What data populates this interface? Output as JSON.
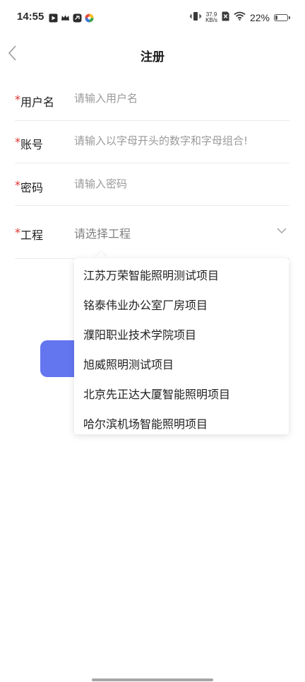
{
  "status_bar": {
    "time": "14:55",
    "net_speed_value": "37.9",
    "net_speed_unit": "KB/s",
    "battery_percent": "22%",
    "battery_level": 0.22
  },
  "nav": {
    "title": "注册"
  },
  "form": {
    "required_mark": "*",
    "username": {
      "label": "用户名",
      "placeholder": "请输入用户名"
    },
    "account": {
      "label": "账号",
      "placeholder": "请输入以字母开头的数字和字母组合!"
    },
    "password": {
      "label": "密码",
      "placeholder": "请输入密码"
    },
    "project": {
      "label": "工程",
      "placeholder": "请选择工程"
    }
  },
  "dropdown": {
    "options": [
      "江苏万荣智能照明测试项目",
      "铭泰伟业办公室厂房项目",
      "濮阳职业技术学院项目",
      "旭威照明测试项目",
      "北京先正达大厦智能照明项目",
      "哈尔滨机场智能照明项目"
    ]
  },
  "colors": {
    "accent": "#6376f0",
    "required": "#e0322d",
    "placeholder": "#9a9a9a"
  }
}
